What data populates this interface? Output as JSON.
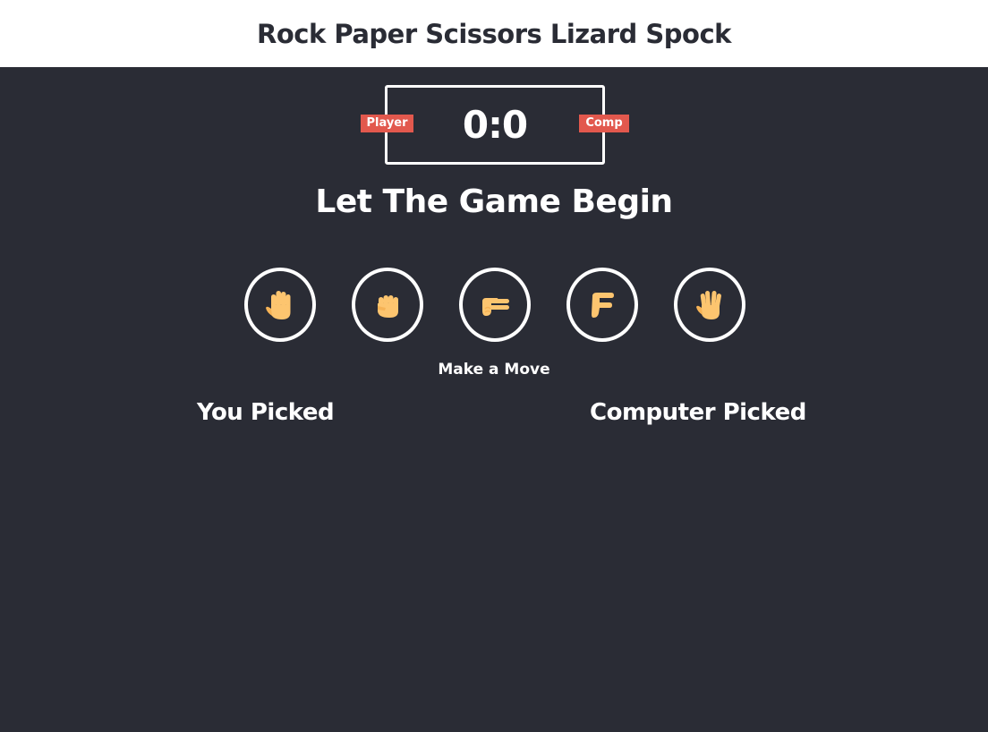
{
  "header": {
    "title": "Rock Paper Scissors Lizard Spock"
  },
  "scoreboard": {
    "score": "0:0",
    "player_label": "Player",
    "comp_label": "Comp"
  },
  "message": "Let The Game Begin",
  "choices": [
    {
      "name": "paper",
      "icon": "raised-hand-icon"
    },
    {
      "name": "rock",
      "icon": "raised-fist-icon"
    },
    {
      "name": "scissors",
      "icon": "victory-hand-icon"
    },
    {
      "name": "lizard",
      "icon": "lizard-hand-icon"
    },
    {
      "name": "spock",
      "icon": "vulcan-salute-icon"
    }
  ],
  "prompt": "Make a Move",
  "results": {
    "you_label": "You Picked",
    "computer_label": "Computer Picked"
  },
  "colors": {
    "background": "#2a2c35",
    "header_bg": "#ffffff",
    "badge": "#e2584d",
    "hand_skin": "#fdc56f"
  }
}
